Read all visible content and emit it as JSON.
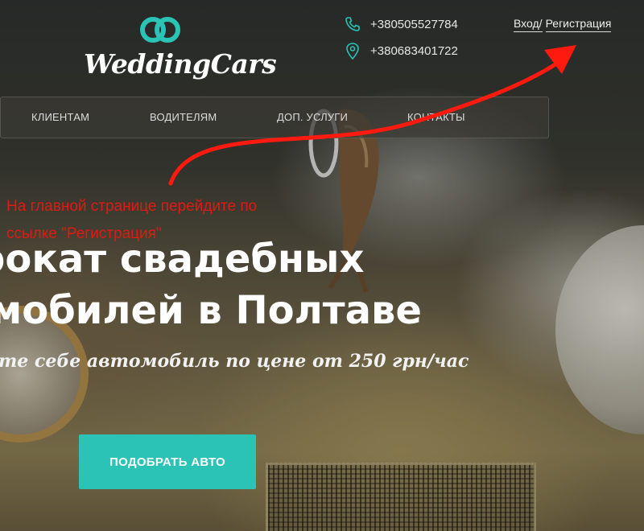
{
  "brand": {
    "name": "WeddingCars",
    "accent": "#2ac3b5"
  },
  "contacts": [
    {
      "icon": "phone-icon",
      "text": "+380505527784"
    },
    {
      "icon": "location-pin-icon",
      "text": "+380683401722"
    }
  ],
  "auth": {
    "login": "Вход/",
    "register": "Регистрация"
  },
  "nav": {
    "items": [
      "КЛИЕНТАМ",
      "ВОДИТЕЛЯМ",
      "ДОП. УСЛУГИ",
      "КОНТАКТЫ"
    ]
  },
  "hero": {
    "title_line1": "рокат свадебных",
    "title_line2": "мобилей в Полтаве",
    "subtitle": "те себе автомобиль по цене от 250 грн/час",
    "cta_label": "ПОДОБРАТЬ АВТО"
  },
  "annotation": {
    "line1": "На главной странице перейдите по",
    "line2": "ссылке \"Регистрация\"",
    "color": "#e01a12"
  }
}
